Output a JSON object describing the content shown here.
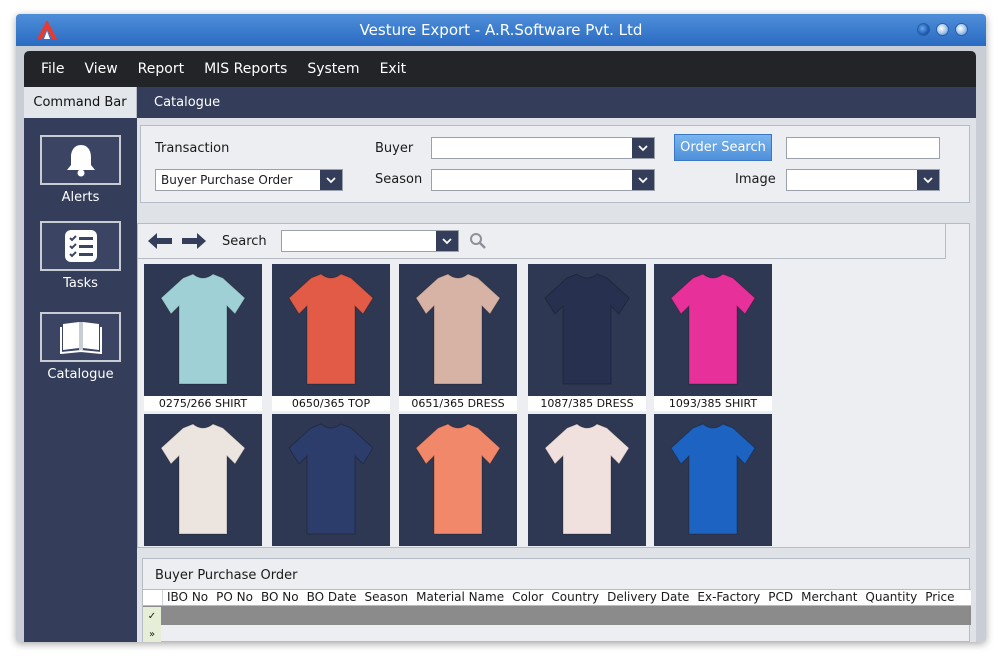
{
  "window": {
    "title": "Vesture Export - A.R.Software Pvt. Ltd"
  },
  "menu": [
    "File",
    "View",
    "Report",
    "MIS Reports",
    "System",
    "Exit"
  ],
  "tabs": {
    "command_bar": "Command Bar",
    "catalogue": "Catalogue"
  },
  "sidebar": {
    "items": [
      {
        "label": "Alerts",
        "icon": "bell-icon"
      },
      {
        "label": "Tasks",
        "icon": "checklist-icon"
      },
      {
        "label": "Catalogue",
        "icon": "book-icon"
      }
    ]
  },
  "filters": {
    "transaction_label": "Transaction",
    "transaction_value": "Buyer Purchase Order",
    "buyer_label": "Buyer",
    "buyer_value": "",
    "season_label": "Season",
    "season_value": "",
    "order_search_button": "Order Search",
    "order_search_value": "",
    "image_label": "Image",
    "image_value": ""
  },
  "gallery": {
    "search_label": "Search",
    "search_value": "",
    "items": [
      {
        "caption": "0275/266 SHIRT",
        "color": "#9fd0d6"
      },
      {
        "caption": "0650/365 TOP",
        "color": "#e25b47"
      },
      {
        "caption": "0651/365 DRESS",
        "color": "#d7b3a6"
      },
      {
        "caption": "1087/385 DRESS",
        "color": "#27314f"
      },
      {
        "caption": "1093/385 SHIRT",
        "color": "#e8309b"
      },
      {
        "caption": "",
        "color": "#ece4df"
      },
      {
        "caption": "",
        "color": "#2c3d6b"
      },
      {
        "caption": "",
        "color": "#f1886a"
      },
      {
        "caption": "",
        "color": "#f0e0de"
      },
      {
        "caption": "",
        "color": "#1c63c2"
      }
    ]
  },
  "order_grid": {
    "title": "Buyer Purchase Order",
    "columns": [
      "IBO No",
      "PO No",
      "BO No",
      "BO Date",
      "Season",
      "Material Name",
      "Color",
      "Country",
      "Delivery Date",
      "Ex-Factory",
      "PCD",
      "Merchant",
      "Quantity",
      "Price"
    ]
  }
}
